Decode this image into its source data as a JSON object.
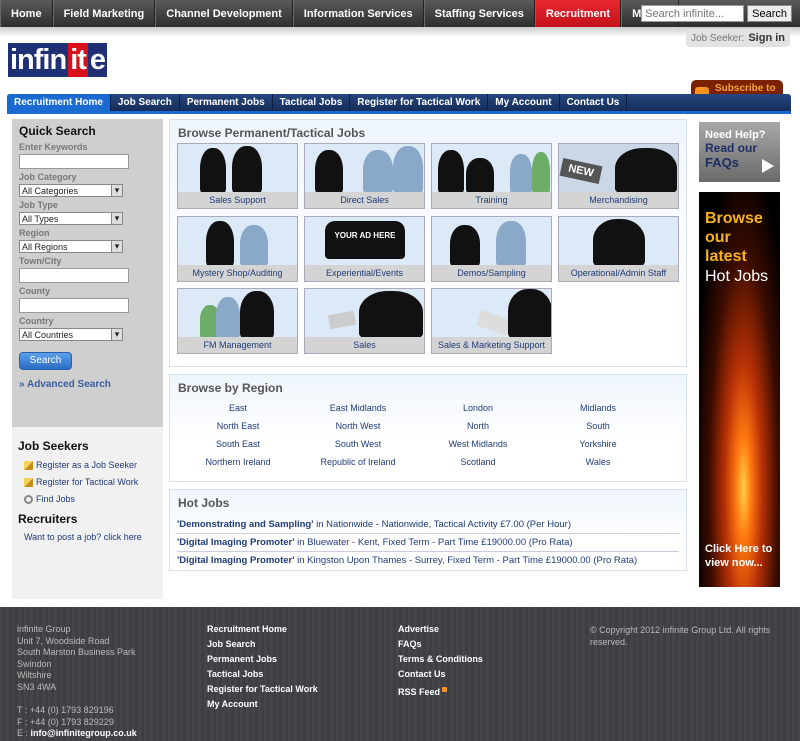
{
  "topnav": {
    "items": [
      "Home",
      "Field Marketing",
      "Channel Development",
      "Information Services",
      "Staffing Services",
      "Recruitment",
      "More »"
    ],
    "active_index": 5,
    "search_placeholder": "Search infinite...",
    "search_button": "Search"
  },
  "header": {
    "logo_text": "infinite",
    "signin_prefix": "Job Seeker:",
    "signin_label": "Sign in",
    "rss_label": "Subscribe to RSS feed"
  },
  "mainnav": {
    "items": [
      "Recruitment Home",
      "Job Search",
      "Permanent Jobs",
      "Tactical Jobs",
      "Register for Tactical Work",
      "My Account",
      "Contact Us"
    ],
    "active_index": 0
  },
  "quicksearch": {
    "title": "Quick Search",
    "keywords_label": "Enter Keywords",
    "category_label": "Job Category",
    "category_value": "All Categories",
    "type_label": "Job Type",
    "type_value": "All Types",
    "region_label": "Region",
    "region_value": "All Regions",
    "town_label": "Town/City",
    "county_label": "County",
    "country_label": "Country",
    "country_value": "All Countries",
    "search_button": "Search",
    "advanced": "» Advanced Search"
  },
  "jobseekers": {
    "title": "Job Seekers",
    "links": [
      "Register as a Job Seeker",
      "Register for Tactical Work",
      "Find Jobs"
    ],
    "recruiters_title": "Recruiters",
    "recruiters_link": "Want to post a job? click here"
  },
  "browse": {
    "title": "Browse Permanent/Tactical Jobs",
    "tiles": [
      "Sales Support",
      "Direct Sales",
      "Training",
      "Merchandising",
      "Mystery Shop/Auditing",
      "Experiential/Events",
      "Demos/Sampling",
      "Operational/Admin Staff",
      "FM Management",
      "Sales",
      "Sales & Marketing Support"
    ],
    "art_text": {
      "new": "NEW",
      "ad": "YOUR AD HERE"
    }
  },
  "region": {
    "title": "Browse by Region",
    "items": [
      "East",
      "East Midlands",
      "London",
      "Midlands",
      "North East",
      "North West",
      "North",
      "South",
      "South East",
      "South West",
      "West Midlands",
      "Yorkshire",
      "Northern Ireland",
      "Republic of Ireland",
      "Scotland",
      "Wales"
    ]
  },
  "hotjobs": {
    "title": "Hot Jobs",
    "items": [
      {
        "title": "'Demonstrating and Sampling'",
        "rest": " in Nationwide - Nationwide, Tactical Activity £7.00 (Per Hour)"
      },
      {
        "title": "'Digital Imaging Promoter'",
        "rest": " in Bluewater - Kent, Fixed Term - Part Time £19000.00 (Pro Rata)"
      },
      {
        "title": "'Digital Imaging Promoter'",
        "rest": " in Kingston Upon Thames - Surrey, Fixed Term - Part Time £19000.00 (Pro Rata)"
      }
    ]
  },
  "right": {
    "needhelp_1": "Need Help?",
    "needhelp_2": "Read our",
    "needhelp_3": "FAQs",
    "ad_l1": "Browse",
    "ad_l2": "our",
    "ad_l3": "latest",
    "ad_l4": "Hot Jobs",
    "ad_click_1": "Click Here to",
    "ad_click_2": "view now..."
  },
  "footer": {
    "address": [
      "infinite Group",
      "Unit 7, Woodside Road",
      "South Marston Business Park",
      "Swindon",
      "Wiltshire",
      "SN3 4WA"
    ],
    "tel": "T : +44 (0) 1793 829196",
    "fax": "F : +44 (0) 1793 829229",
    "email_prefix": "E :",
    "email": "info@infinitegroup.co.uk",
    "links1": [
      "Recruitment Home",
      "Job Search",
      "Permanent Jobs",
      "Tactical Jobs",
      "Register for Tactical Work",
      "My Account"
    ],
    "links2": [
      "Advertise",
      "FAQs",
      "Terms & Conditions",
      "Contact Us",
      "RSS Feed"
    ],
    "copyright": "© Copyright 2012 infinite Group Ltd. All rights reserved."
  }
}
